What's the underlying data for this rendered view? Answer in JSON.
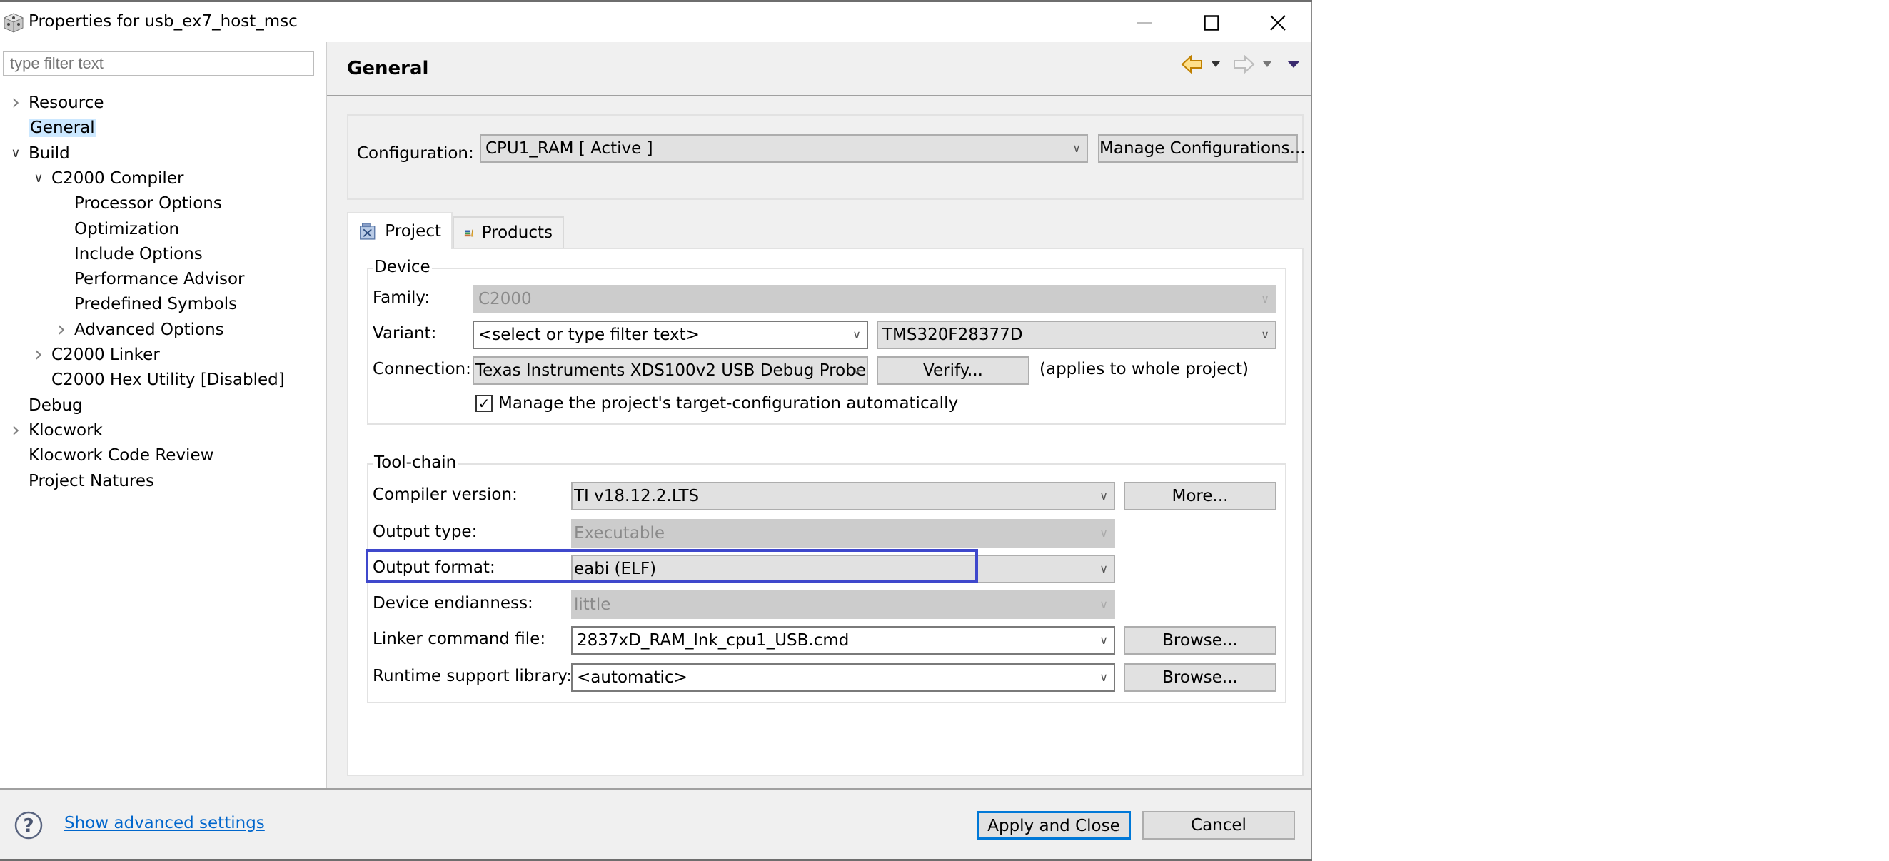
{
  "window": {
    "title": "Properties for usb_ex7_host_msc",
    "icon": "cube-icon",
    "controls": {
      "minimize": "minimize-icon",
      "maximize": "maximize-icon",
      "close": "close-icon"
    }
  },
  "sidebar": {
    "filter_placeholder": "type filter text",
    "items": [
      {
        "label": "Resource",
        "level": 0,
        "twisty": "collapsed"
      },
      {
        "label": "General",
        "level": 0,
        "twisty": "none",
        "selected": true
      },
      {
        "label": "Build",
        "level": 0,
        "twisty": "expanded"
      },
      {
        "label": "C2000 Compiler",
        "level": 1,
        "twisty": "expanded"
      },
      {
        "label": "Processor Options",
        "level": 2,
        "twisty": "none"
      },
      {
        "label": "Optimization",
        "level": 2,
        "twisty": "none"
      },
      {
        "label": "Include Options",
        "level": 2,
        "twisty": "none"
      },
      {
        "label": "Performance Advisor",
        "level": 2,
        "twisty": "none"
      },
      {
        "label": "Predefined Symbols",
        "level": 2,
        "twisty": "none"
      },
      {
        "label": "Advanced Options",
        "level": 2,
        "twisty": "collapsed"
      },
      {
        "label": "C2000 Linker",
        "level": 1,
        "twisty": "collapsed"
      },
      {
        "label": "C2000 Hex Utility  [Disabled]",
        "level": 1,
        "twisty": "none"
      },
      {
        "label": "Debug",
        "level": 0,
        "twisty": "none"
      },
      {
        "label": "Klocwork",
        "level": 0,
        "twisty": "collapsed"
      },
      {
        "label": "Klocwork Code Review",
        "level": 0,
        "twisty": "none"
      },
      {
        "label": "Project Natures",
        "level": 0,
        "twisty": "none"
      }
    ]
  },
  "main": {
    "title": "General",
    "nav": {
      "back": "back-arrow-icon",
      "forward": "forward-arrow-icon",
      "menu": "view-menu-icon"
    },
    "configuration": {
      "label": "Configuration:",
      "value": "CPU1_RAM  [ Active ]",
      "manage_button": "Manage Configurations..."
    },
    "tabs": [
      {
        "label": "Project",
        "icon": "project-icon",
        "active": true
      },
      {
        "label": "Products",
        "icon": "products-icon",
        "active": false
      }
    ],
    "device": {
      "title": "Device",
      "family_label": "Family:",
      "family_value": "C2000",
      "variant_label": "Variant:",
      "variant_filter_placeholder": "<select or type filter text>",
      "variant_value": "TMS320F28377D",
      "connection_label": "Connection:",
      "connection_value": "Texas Instruments XDS100v2 USB Debug Probe",
      "verify_button": "Verify...",
      "connection_note": "(applies to whole project)",
      "manage_target_checkbox": {
        "label": "Manage the project's target-configuration automatically",
        "checked": true
      }
    },
    "toolchain": {
      "title": "Tool-chain",
      "compiler_version_label": "Compiler version:",
      "compiler_version_value": "TI v18.12.2.LTS",
      "more_button": "More...",
      "output_type_label": "Output type:",
      "output_type_value": "Executable",
      "output_format_label": "Output format:",
      "output_format_value": "eabi (ELF)",
      "endianness_label": "Device endianness:",
      "endianness_value": "little",
      "linker_cmd_label": "Linker command file:",
      "linker_cmd_value": "2837xD_RAM_lnk_cpu1_USB.cmd",
      "runtime_lib_label": "Runtime support library:",
      "runtime_lib_value": "<automatic>",
      "browse_button": "Browse..."
    },
    "highlight_color": "#3f48cc"
  },
  "footer": {
    "help_icon": "help-icon",
    "advanced_link": "Show advanced settings",
    "apply_button": "Apply and Close",
    "cancel_button": "Cancel"
  }
}
